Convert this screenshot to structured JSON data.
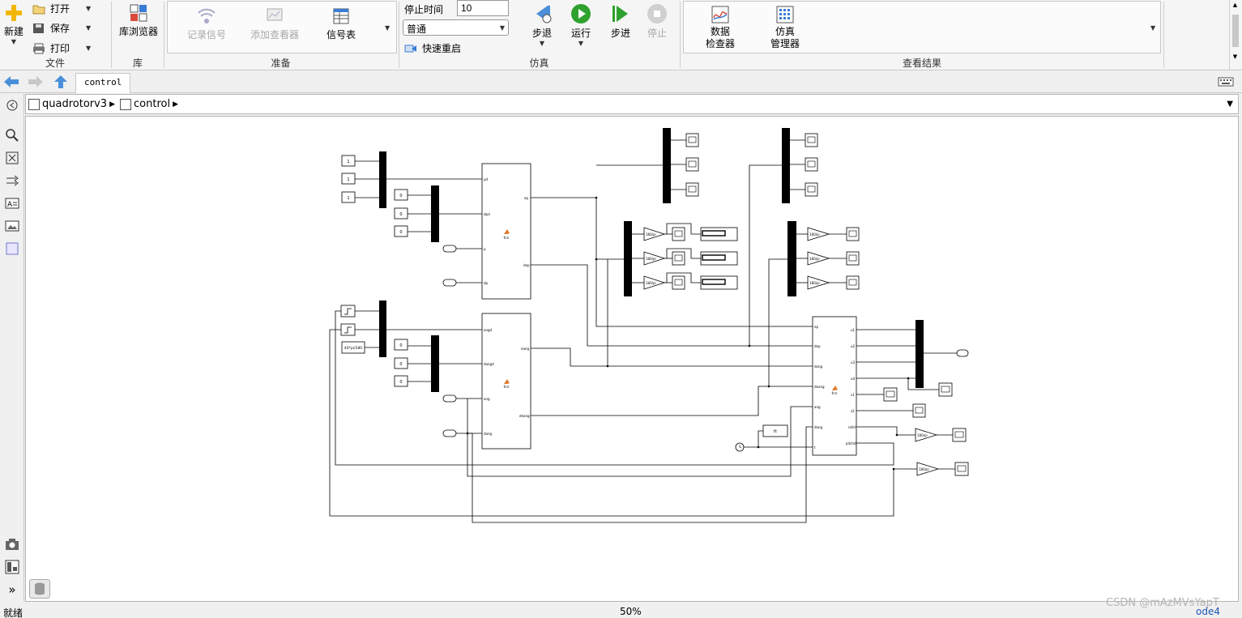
{
  "ribbon": {
    "file_group": {
      "label": "文件",
      "new_label": "新建",
      "open_label": "打开",
      "save_label": "保存",
      "print_label": "打印"
    },
    "library_group": {
      "label": "库",
      "library_browser_label": "库浏览器"
    },
    "prepare_group": {
      "label": "准备",
      "log_signals_label": "记录信号",
      "add_viewer_label": "添加查看器",
      "signal_table_label": "信号表"
    },
    "simulation_group": {
      "label": "仿真",
      "stop_time_label": "停止时间",
      "stop_time_value": "10",
      "mode_value": "普通",
      "fast_restart_label": "快速重启",
      "step_back_label": "步退",
      "run_label": "运行",
      "step_forward_label": "步进",
      "stop_label": "停止"
    },
    "review_group": {
      "label": "查看结果",
      "data_inspector_line1": "数据",
      "data_inspector_line2": "检查器",
      "sim_manager_line1": "仿真",
      "sim_manager_line2": "管理器"
    }
  },
  "navbar": {
    "tab_label": "control"
  },
  "breadcrumb": {
    "items": [
      "quadrotorv3",
      "control"
    ]
  },
  "diagram": {
    "const_one": "1",
    "const_zero": "0",
    "deg_const": "40*pi/180",
    "gain_label": "180/pi",
    "fcn_label": "fcn",
    "t_label": "tt",
    "fcn1_ports_in": [
      "pd",
      "dpd",
      "p",
      "dp"
    ],
    "fcn1_ports_out": [
      "ep",
      "dep"
    ],
    "fcn2_ports_in": [
      "angd",
      "dangd",
      "ang",
      "dang"
    ],
    "fcn2_ports_out": [
      "eang",
      "deang"
    ],
    "fcn3_ports_in": [
      "ep",
      "dep",
      "dang",
      "deang",
      "ang",
      "dang",
      "t"
    ],
    "fcn3_ports_out": [
      "u1",
      "u2",
      "u3",
      "u4",
      "s1",
      "s2",
      "rolld",
      "pitchd"
    ]
  },
  "statusbar": {
    "status": "就绪",
    "zoom": "50%",
    "solver": "ode4",
    "watermark": "CSDN @mAzMVsYapT"
  },
  "colors": {
    "run_green": "#2ea12e",
    "solver_blue": "#1a56b0",
    "accent_orange": "#e07a2e"
  }
}
